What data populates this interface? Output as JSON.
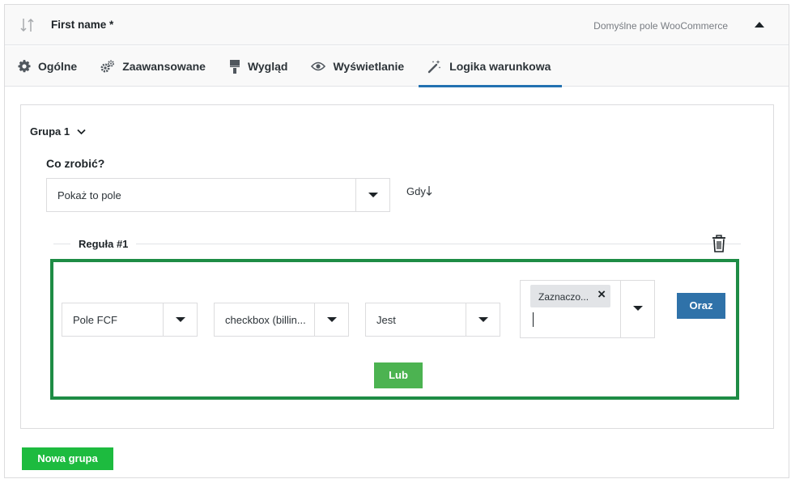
{
  "header": {
    "field_title": "First name *",
    "field_type": "Domyślne pole WooCommerce"
  },
  "tabs": [
    {
      "label": "Ogólne",
      "icon": "gear-icon"
    },
    {
      "label": "Zaawansowane",
      "icon": "gears-icon"
    },
    {
      "label": "Wygląd",
      "icon": "paint-roller-icon"
    },
    {
      "label": "Wyświetlanie",
      "icon": "eye-icon"
    },
    {
      "label": "Logika warunkowa",
      "icon": "magic-wand-icon",
      "active": true
    }
  ],
  "group": {
    "title": "Grupa 1",
    "action_label": "Co zrobić?",
    "action_value": "Pokaż to pole",
    "when_label": "Gdy"
  },
  "rule": {
    "title": "Reguła #1",
    "field_source": "Pole FCF",
    "field_name": "checkbox (billin...",
    "operator": "Jest",
    "value_tag": "Zaznaczo...",
    "and_button": "Oraz",
    "or_button": "Lub"
  },
  "new_group_button": "Nowa grupa",
  "colors": {
    "accent_blue": "#2271b1",
    "rule_border": "#1e8c45",
    "or_button": "#4cb351",
    "new_group_button": "#1dbb3f",
    "and_button": "#2f72a9"
  }
}
